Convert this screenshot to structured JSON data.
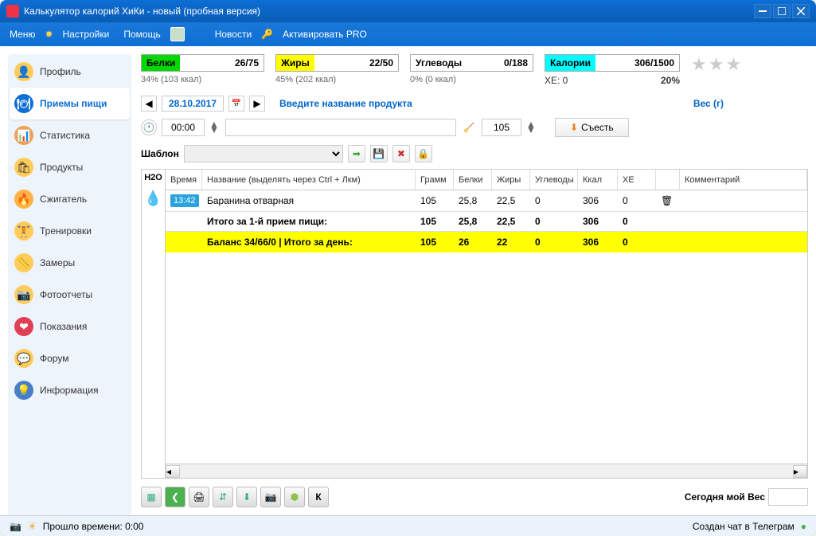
{
  "window": {
    "title": "Калькулятор калорий ХиКи - новый (пробная версия)"
  },
  "menubar": {
    "menu": "Меню",
    "settings": "Настройки",
    "help": "Помощь",
    "news": "Новости",
    "activate": "Активировать PRO"
  },
  "sidebar": {
    "profile": "Профиль",
    "meals": "Приемы пищи",
    "stats": "Статистика",
    "products": "Продукты",
    "burner": "Сжигатель",
    "trainings": "Тренировки",
    "measures": "Замеры",
    "photo": "Фотоотчеты",
    "indications": "Показания",
    "forum": "Форум",
    "info": "Информация"
  },
  "macros": {
    "protein": {
      "label": "Белки",
      "value": "26/75",
      "sub": "34% (103 ккал)",
      "color": "#00d800"
    },
    "fat": {
      "label": "Жиры",
      "value": "22/50",
      "sub": "45% (202 ккал)",
      "color": "#ffff00"
    },
    "carb": {
      "label": "Углеводы",
      "value": "0/188",
      "sub": "0% (0 ккал)",
      "color": "#ffffff"
    },
    "kcal": {
      "label": "Калории",
      "value": "306/1500",
      "xe": "ХЕ: 0",
      "pct": "20%",
      "color": "#00ffff"
    }
  },
  "controls": {
    "date": "28.10.2017",
    "product_placeholder": "Введите название продукта",
    "weight_label": "Вес (г)",
    "time": "00:00",
    "weight": "105",
    "eat": "Съесть",
    "template_label": "Шаблон"
  },
  "table": {
    "h2o": "H2O",
    "headers": {
      "time": "Время",
      "name": "Название (выделять через Ctrl + Лкм)",
      "gram": "Грамм",
      "prot": "Белки",
      "fat": "Жиры",
      "carb": "Углеводы",
      "kcal": "Ккал",
      "xe": "ХЕ",
      "comment": "Комментарий"
    },
    "row1": {
      "time": "13:42",
      "name": "Баранина отварная",
      "gram": "105",
      "prot": "25,8",
      "fat": "22,5",
      "carb": "0",
      "kcal": "306",
      "xe": "0"
    },
    "subtotal": {
      "name": "Итого за 1-й прием пищи:",
      "gram": "105",
      "prot": "25,8",
      "fat": "22,5",
      "carb": "0",
      "kcal": "306",
      "xe": "0"
    },
    "total": {
      "name": "Баланс 34/66/0  |  Итого за день:",
      "gram": "105",
      "prot": "26",
      "fat": "22",
      "carb": "0",
      "kcal": "306",
      "xe": "0"
    }
  },
  "footer": {
    "k": "К",
    "weight_today": "Сегодня мой Вес"
  },
  "statusbar": {
    "elapsed": "Прошло времени: 0:00",
    "telegram": "Создан чат в Телеграм"
  }
}
